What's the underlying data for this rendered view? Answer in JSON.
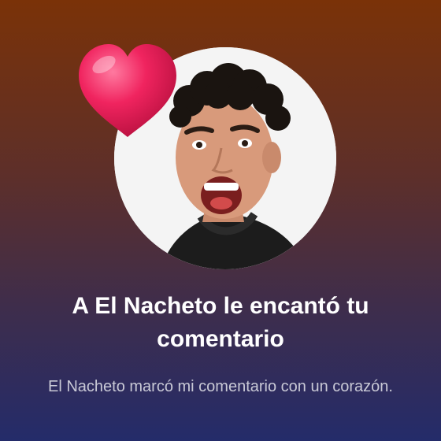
{
  "notification": {
    "title": "A El Nacheto le encantó tu comentario",
    "subtitle": "El Nacheto marcó mi comentario con un corazón.",
    "avatar_icon": "profile-photo",
    "heart_icon": "heart-icon",
    "colors": {
      "gradient_top": "#7a3208",
      "gradient_bottom": "#242c6a",
      "heart": "#f0245f",
      "title_text": "#ffffff",
      "subtitle_text": "#c9c9d6"
    }
  }
}
